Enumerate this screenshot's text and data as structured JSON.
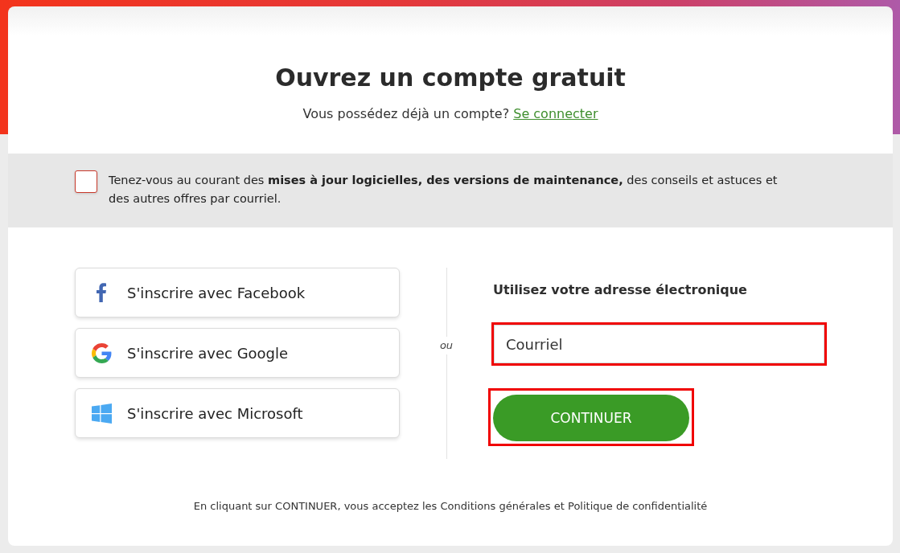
{
  "heading": "Ouvrez un compte gratuit",
  "signin_prompt": {
    "text": "Vous possédez déjà un compte?",
    "link": "Se connecter"
  },
  "newsletter": {
    "checked": false,
    "text": "Tenez-vous au courant des **mises à jour logicielles, des versions de maintenance,** des conseils et astuces et des autres offres par courriel."
  },
  "social_buttons": [
    {
      "kind": "facebook",
      "label": "S'inscrire avec Facebook"
    },
    {
      "kind": "google",
      "label": "S'inscrire avec Google"
    },
    {
      "kind": "microsoft",
      "label": "S'inscrire avec Microsoft"
    }
  ],
  "separator": "ou",
  "email_form": {
    "heading": "Utilisez votre adresse électronique",
    "email_field": {
      "placeholder": "Courriel",
      "highlighted": true
    },
    "continue_button": {
      "label": "CONTINUER",
      "highlighted": true
    }
  },
  "legal_text": "En cliquant sur CONTINUER, vous acceptez les Conditions générales et Politique de confidentialité"
}
